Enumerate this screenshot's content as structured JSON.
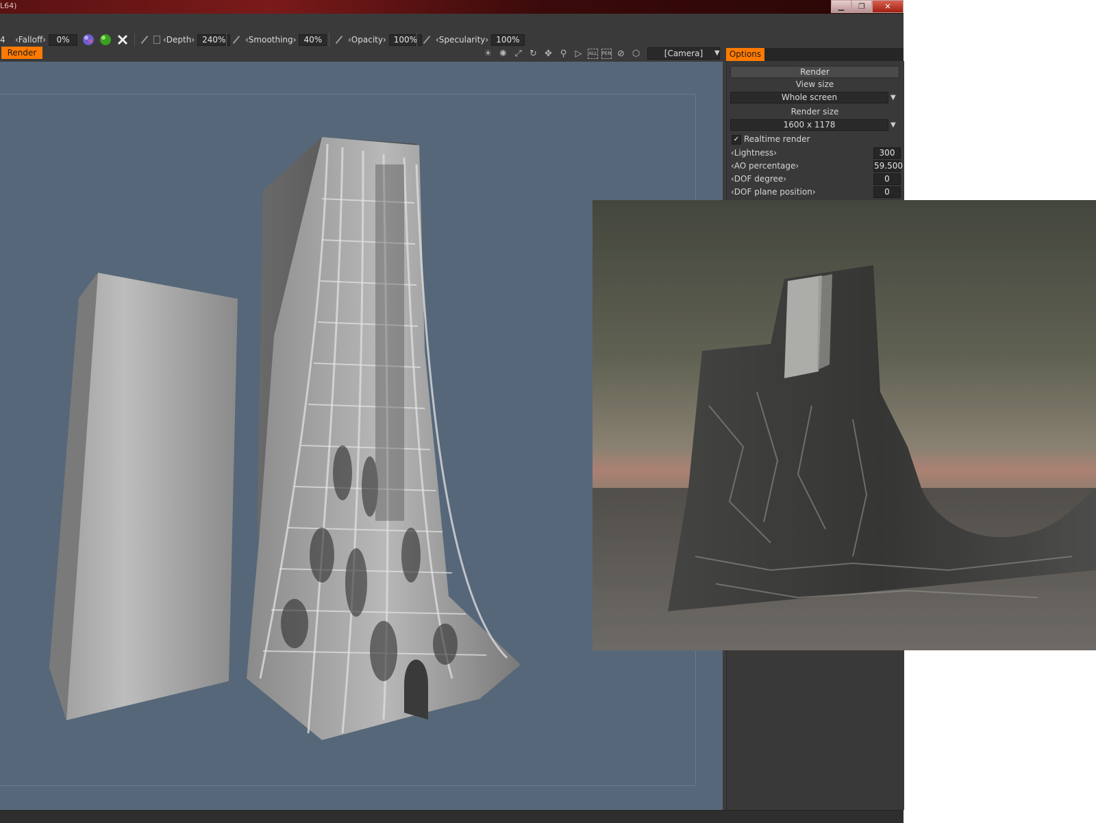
{
  "window": {
    "title": "L64)",
    "minimize_label": "▁",
    "maximize_label": "❐",
    "close_label": "✕"
  },
  "toolbar": {
    "clip_left": "4",
    "falloff": {
      "label": "‹Falloff›",
      "value": "0%"
    },
    "depth": {
      "label": "‹Depth›",
      "value": "240%"
    },
    "smoothing": {
      "label": "‹Smoothing›",
      "value": "40%"
    },
    "opacity": {
      "label": "‹Opacity›",
      "value": "100%"
    },
    "specularity": {
      "label": "‹Specularity›",
      "value": "100%"
    }
  },
  "tabs": {
    "render": "Render",
    "options": "Options"
  },
  "view": {
    "camera": "[Camera]",
    "tool_all": "ALL",
    "tool_pen": "PEN"
  },
  "panel": {
    "render_button": "Render",
    "view_size_label": "View size",
    "view_size_value": "Whole screen",
    "render_size_label": "Render size",
    "render_size_value": "1600 x 1178",
    "realtime_render_label": "Realtime render",
    "realtime_render_checked": true,
    "lightness": {
      "label": "‹Lightness›",
      "value": "300"
    },
    "ao_percentage": {
      "label": "‹AO percentage›",
      "value": "59.500"
    },
    "dof_degree": {
      "label": "‹DOF degree›",
      "value": "0"
    },
    "dof_plane_position": {
      "label": "‹DOF plane position›",
      "value": "0"
    }
  },
  "colors": {
    "accent_orange": "#ff7a00",
    "viewport_bg": "#566779",
    "panel_bg": "#393939",
    "titlebar": "#6a1414"
  }
}
